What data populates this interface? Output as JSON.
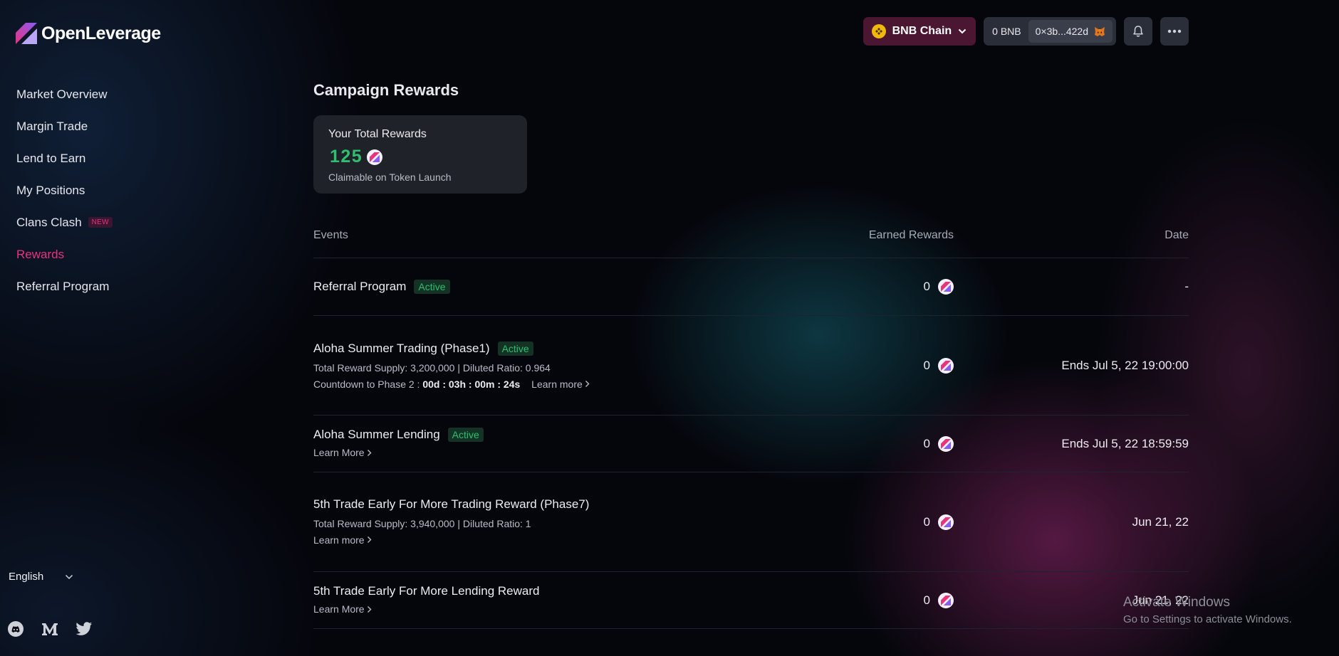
{
  "app": {
    "logo_text": "OpenLeverage"
  },
  "sidebar": {
    "items": [
      {
        "label": "Market Overview"
      },
      {
        "label": "Margin Trade"
      },
      {
        "label": "Lend to Earn"
      },
      {
        "label": "My Positions"
      },
      {
        "label": "Clans Clash",
        "badge": "NEW"
      },
      {
        "label": "Rewards",
        "active": true
      },
      {
        "label": "Referral Program"
      }
    ],
    "language": "English",
    "socials": [
      "discord-icon",
      "medium-icon",
      "twitter-icon"
    ]
  },
  "topbar": {
    "chain": "BNB Chain",
    "balance": "0 BNB",
    "address": "0×3b...422d"
  },
  "main": {
    "title": "Campaign Rewards",
    "total": {
      "label": "Your Total Rewards",
      "value": "125",
      "sub": "Claimable on Token Launch"
    },
    "table": {
      "headers": {
        "events": "Events",
        "earned": "Earned Rewards",
        "date": "Date"
      },
      "rows": [
        {
          "title": "Referral Program",
          "status": "Active",
          "earned": "0",
          "date": "-"
        },
        {
          "title": "Aloha Summer Trading (Phase1)",
          "status": "Active",
          "detail": "Total Reward Supply: 3,200,000 | Diluted Ratio: 0.964",
          "countdown_label": "Countdown to Phase 2 :",
          "countdown_value": "00d : 03h : 00m : 24s",
          "learn": "Learn more",
          "earned": "0",
          "date": "Ends Jul 5, 22 19:00:00"
        },
        {
          "title": "Aloha Summer Lending",
          "status": "Active",
          "learn": "Learn More",
          "earned": "0",
          "date": "Ends Jul 5, 22 18:59:59"
        },
        {
          "title": "5th Trade Early For More Trading Reward (Phase7)",
          "detail": "Total Reward Supply: 3,940,000 | Diluted Ratio: 1",
          "learn": "Learn more",
          "earned": "0",
          "date": "Jun 21, 22"
        },
        {
          "title": "5th Trade Early For More Lending Reward",
          "learn": "Learn More",
          "earned": "0",
          "date": "Jun 21, 22"
        }
      ]
    }
  },
  "watermark": {
    "title": "Activate Windows",
    "subtitle": "Go to Settings to activate Windows."
  },
  "colors": {
    "accent": "#e8337f",
    "active_green": "#2fbf71",
    "chain_bg": "#4a1632"
  }
}
